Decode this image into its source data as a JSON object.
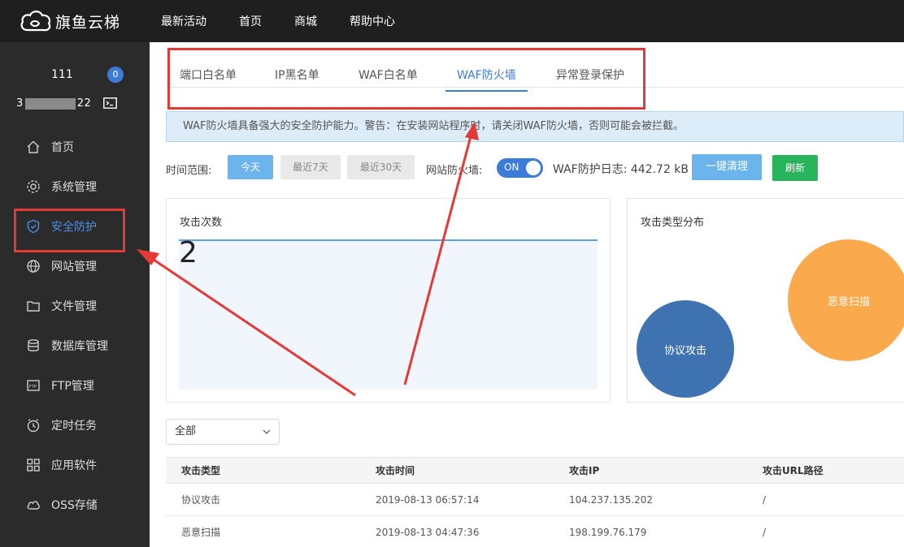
{
  "brand": {
    "name": "旗鱼云梯"
  },
  "topnav": [
    "最新活动",
    "首页",
    "商城",
    "帮助中心"
  ],
  "user": {
    "name": "111",
    "badge": "0"
  },
  "server": {
    "ip_prefix": "3",
    "ip_suffix": "22"
  },
  "sidebar": {
    "items": [
      {
        "label": "首页",
        "icon": "home-icon"
      },
      {
        "label": "系统管理",
        "icon": "gear-icon"
      },
      {
        "label": "安全防护",
        "icon": "shield-icon"
      },
      {
        "label": "网站管理",
        "icon": "globe-icon"
      },
      {
        "label": "文件管理",
        "icon": "folder-icon"
      },
      {
        "label": "数据库管理",
        "icon": "database-icon"
      },
      {
        "label": "FTP管理",
        "icon": "ftp-icon"
      },
      {
        "label": "定时任务",
        "icon": "clock-icon"
      },
      {
        "label": "应用软件",
        "icon": "apps-icon"
      },
      {
        "label": "OSS存储",
        "icon": "cloud-icon"
      }
    ],
    "active_index": 2
  },
  "tabs": [
    {
      "label": "端口白名单"
    },
    {
      "label": "IP黑名单"
    },
    {
      "label": "WAF白名单"
    },
    {
      "label": "WAF防火墙"
    },
    {
      "label": "异常登录保护"
    }
  ],
  "active_tab": 3,
  "alert": "WAF防火墙具备强大的安全防护能力。警告：在安装网站程序时，请关闭WAF防火墙，否则可能会被拦截。",
  "filter": {
    "range_label": "时间范围:",
    "today": "今天",
    "last7": "最近7天",
    "last30": "最近30天",
    "firewall_label": "网站防火墙:",
    "toggle": "ON",
    "log_label": "WAF防护日志: 442.72 kB",
    "clear": "一键清理",
    "refresh": "刷新"
  },
  "attack_count": {
    "title": "攻击次数",
    "value": "2"
  },
  "attack_types": {
    "title": "攻击类型分布",
    "items": [
      {
        "label": "协议攻击",
        "color": "#3f72b0"
      },
      {
        "label": "恶意扫描",
        "color": "#fba94d"
      }
    ]
  },
  "type_select": {
    "value": "全部"
  },
  "table": {
    "headers": [
      "攻击类型",
      "攻击时间",
      "攻击IP",
      "攻击URL路径"
    ],
    "rows": [
      [
        "协议攻击",
        "2019-08-13 06:57:14",
        "104.237.135.202",
        "/"
      ],
      [
        "恶意扫描",
        "2019-08-13 04:47:36",
        "198.199.76.179",
        "/"
      ]
    ]
  }
}
